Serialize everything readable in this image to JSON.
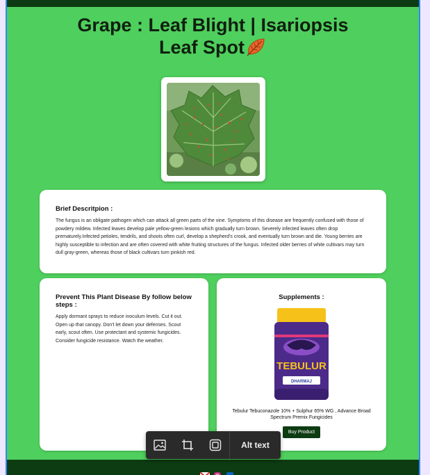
{
  "header": {
    "title_line1": "Grape : Leaf Blight | Isariopsis",
    "title_line2": "Leaf Spot"
  },
  "brief": {
    "heading": "Brief Descritpion :",
    "text": "The fungus is an obligate pathogen which can attack all green parts of the vine. Symptoms of this disease are frequently confused with those of powdery mildew. Infected leaves develop pale yellow-green lesions which gradually turn brown. Severely infected leaves often drop prematurely.Infected petioles, tendrils, and shoots often curl, develop a shepherd's crook, and eventually turn brown and die. Young berries are highly susceptible to infection and are often covered with white fruiting structures of the fungus. Infected older berries of white cultivars may turn dull gray-green, whereas those of black cultivars turn pinkish red."
  },
  "prevent": {
    "heading": "Prevent This Plant Disease By follow below steps :",
    "text": "Apply dormant sprays to reduce inoculum levels. Cut it out. Open up that canopy. Don't let down your defenses. Scout early, scout often. Use protectant and systemic fungicides. Consider fungicide resistance. Watch the weather."
  },
  "supplements": {
    "heading": "Supplements :",
    "product_brand": "TEBULUR",
    "product_maker": "DHARMAJ",
    "product_name": "Tebulur Tebuconazole 10% + Sulphur 65% WG , Advance Broad Spectrum Premix Fungicides",
    "buy_label": "Buy Product"
  },
  "image_toolbar": {
    "alt_text_label": "Alt text"
  },
  "colors": {
    "page_bg": "#4fcf5d",
    "bar_bg": "#0d3b12",
    "card_bg": "#ffffff"
  }
}
